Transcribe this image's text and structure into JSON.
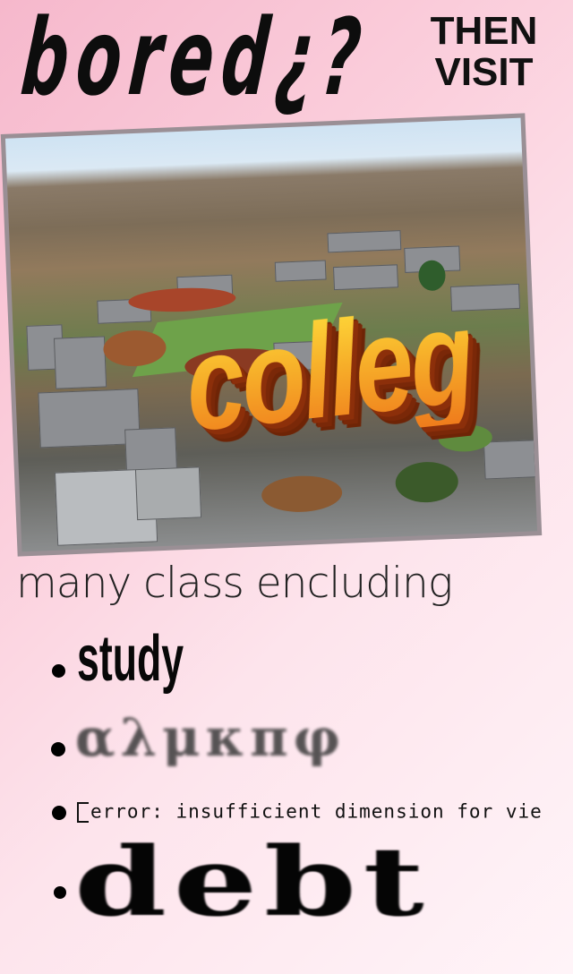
{
  "headline": {
    "bored": "bored¿?",
    "then": "THEN",
    "visit": "VISIT"
  },
  "photo": {
    "overlay_text": "colleg",
    "overlay_colors": [
      "#ffdd3b",
      "#ef7c1c",
      "#8c2f0a"
    ]
  },
  "body": {
    "intro": "many class encluding",
    "items": [
      {
        "label": "study"
      },
      {
        "label": "αλμκπφ"
      },
      {
        "label": "error: insufficient dimension for vie"
      },
      {
        "label": "debt"
      }
    ]
  },
  "colors": {
    "background_start": "#f6b8cc",
    "background_end": "#fff4f8",
    "text": "#0d0d0d"
  }
}
